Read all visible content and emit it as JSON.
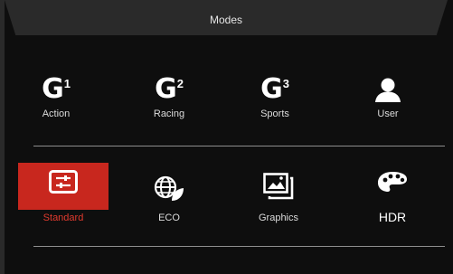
{
  "header": {
    "title": "Modes"
  },
  "row1": [
    {
      "label": "Action",
      "icon": "g1-icon",
      "glyph": "G",
      "sup": "1"
    },
    {
      "label": "Racing",
      "icon": "g2-icon",
      "glyph": "G",
      "sup": "2"
    },
    {
      "label": "Sports",
      "icon": "g3-icon",
      "glyph": "G",
      "sup": "3"
    },
    {
      "label": "User",
      "icon": "user-icon"
    }
  ],
  "row2": [
    {
      "label": "Standard",
      "icon": "sliders-icon",
      "selected": true
    },
    {
      "label": "ECO",
      "icon": "globe-leaf-icon"
    },
    {
      "label": "Graphics",
      "icon": "images-icon"
    },
    {
      "label": "HDR",
      "icon": "palette-icon"
    }
  ],
  "colors": {
    "selected": "#c8271e",
    "selected_text": "#e03a2e",
    "text": "#dcdcdc",
    "background": "#0e0e0e"
  }
}
